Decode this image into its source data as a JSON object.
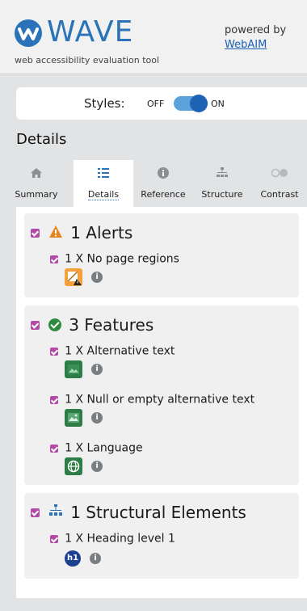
{
  "header": {
    "logo_text": "WAVE",
    "tagline": "web accessibility evaluation tool",
    "powered_by": "powered by",
    "webaim_link": "WebAIM"
  },
  "styles_toggle": {
    "label": "Styles:",
    "off_label": "OFF",
    "on_label": "ON",
    "state": "on"
  },
  "details_title": "Details",
  "tabs": [
    {
      "label": "Summary",
      "icon": "home-icon",
      "active": false
    },
    {
      "label": "Details",
      "icon": "list-icon",
      "active": true
    },
    {
      "label": "Reference",
      "icon": "info-icon",
      "active": false
    },
    {
      "label": "Structure",
      "icon": "structure-icon",
      "active": false
    },
    {
      "label": "Contrast",
      "icon": "contrast-icon",
      "active": false
    }
  ],
  "sections": [
    {
      "heading": "1 Alerts",
      "icon": "alert-triangle-icon",
      "items": [
        {
          "label": "1 X No page regions",
          "icon": "no-regions-icon"
        }
      ]
    },
    {
      "heading": "3 Features",
      "icon": "check-circle-icon",
      "items": [
        {
          "label": "1 X Alternative text",
          "icon": "alt-text-icon"
        },
        {
          "label": "1 X Null or empty alternative text",
          "icon": "null-alt-icon"
        },
        {
          "label": "1 X Language",
          "icon": "language-icon"
        }
      ]
    },
    {
      "heading": "1 Structural Elements",
      "icon": "structure-icon",
      "items": [
        {
          "label": "1 X Heading level 1",
          "icon": "heading-h1-icon",
          "badge": "h1"
        }
      ]
    }
  ],
  "info_glyph": "i",
  "colors": {
    "brand_blue": "#2a73b8",
    "checkbox_purple": "#b04ba8",
    "alert_orange": "#e8831e",
    "feature_green": "#2d8a3e",
    "panel_gray": "#f0f0f0"
  }
}
